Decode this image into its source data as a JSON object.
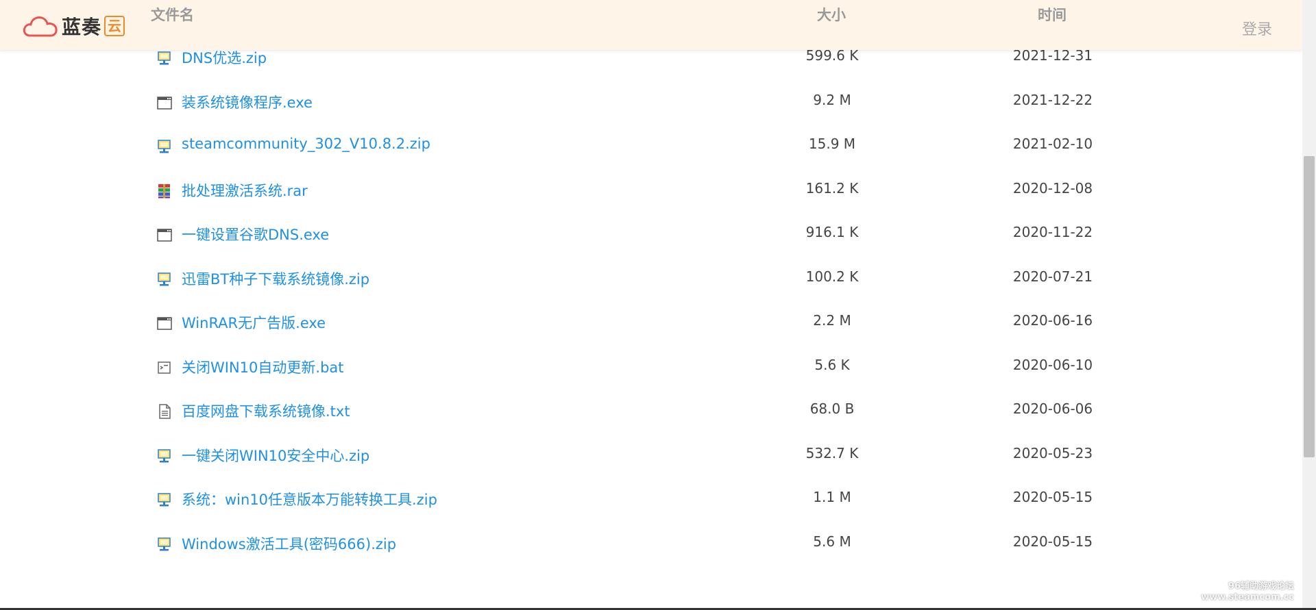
{
  "header": {
    "logo_text": "蓝奏",
    "logo_badge": "云",
    "columns": {
      "name": "文件名",
      "size": "大小",
      "time": "时间"
    },
    "login": "登录"
  },
  "files": [
    {
      "name": "DNS优选.zip",
      "size": "599.6 K",
      "time": "2021-12-31",
      "icon": "zip-icon"
    },
    {
      "name": "装系统镜像程序.exe",
      "size": "9.2 M",
      "time": "2021-12-22",
      "icon": "exe-icon"
    },
    {
      "name": "steamcommunity_302_V10.8.2.zip",
      "size": "15.9 M",
      "time": "2021-02-10",
      "icon": "zip-icon"
    },
    {
      "name": "批处理激活系统.rar",
      "size": "161.2 K",
      "time": "2020-12-08",
      "icon": "rar-icon"
    },
    {
      "name": "一键设置谷歌DNS.exe",
      "size": "916.1 K",
      "time": "2020-11-22",
      "icon": "exe-icon"
    },
    {
      "name": "迅雷BT种子下载系统镜像.zip",
      "size": "100.2 K",
      "time": "2020-07-21",
      "icon": "zip-icon"
    },
    {
      "name": "WinRAR无广告版.exe",
      "size": "2.2 M",
      "time": "2020-06-16",
      "icon": "exe-icon"
    },
    {
      "name": "关闭WIN10自动更新.bat",
      "size": "5.6 K",
      "time": "2020-06-10",
      "icon": "bat-icon"
    },
    {
      "name": "百度网盘下载系统镜像.txt",
      "size": "68.0 B",
      "time": "2020-06-06",
      "icon": "txt-icon"
    },
    {
      "name": "一键关闭WIN10安全中心.zip",
      "size": "532.7 K",
      "time": "2020-05-23",
      "icon": "zip-icon"
    },
    {
      "name": "系统：win10任意版本万能转换工具.zip",
      "size": "1.1 M",
      "time": "2020-05-15",
      "icon": "zip-icon"
    },
    {
      "name": "Windows激活工具(密码666).zip",
      "size": "5.6 M",
      "time": "2020-05-15",
      "icon": "zip-icon"
    }
  ],
  "watermark": {
    "line1": "96辅助游戏论坛",
    "line2": "www.steamcom.cc"
  },
  "colors": {
    "header_bg": "#fff4e8",
    "link": "#1e90e6",
    "logo_accent": "#f08a24",
    "cloud": "#e8554e"
  }
}
